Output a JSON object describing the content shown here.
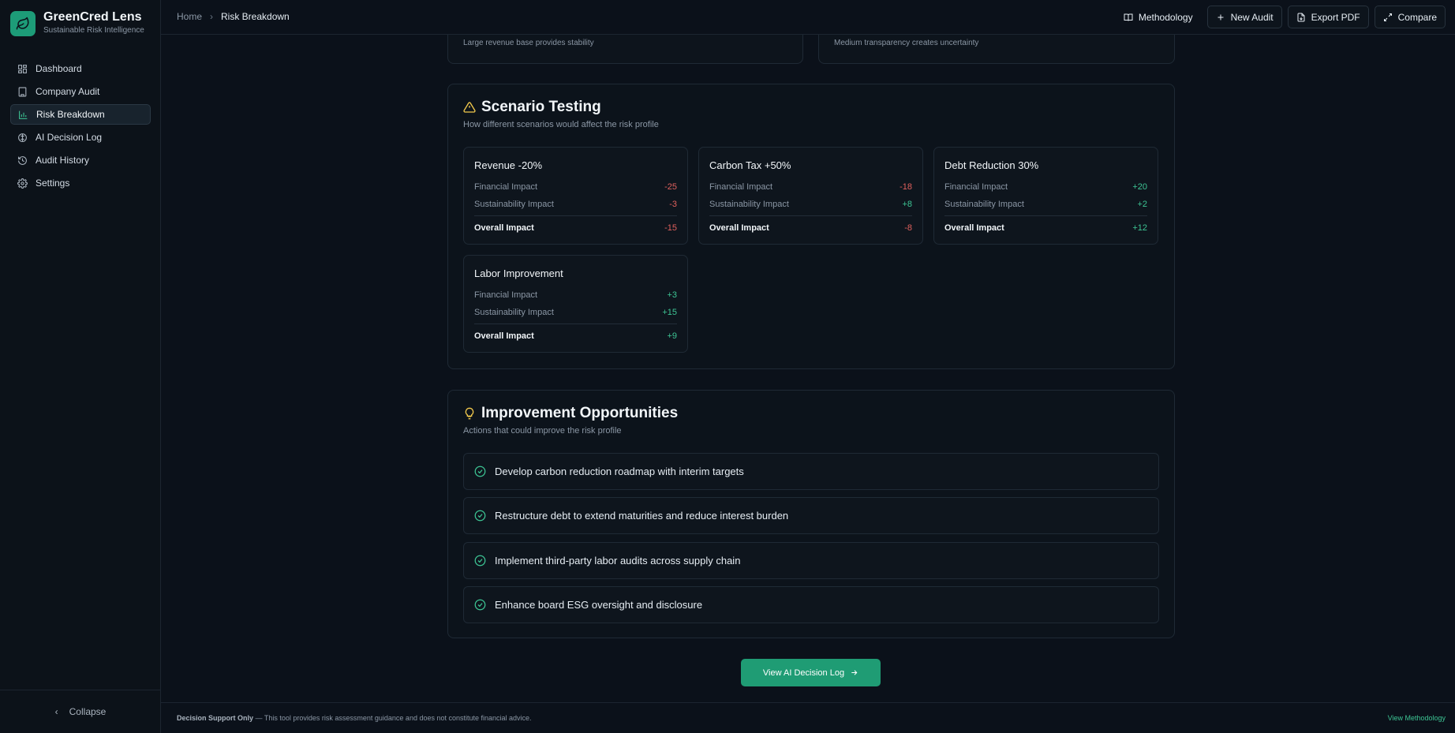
{
  "brand": {
    "name": "GreenCred Lens",
    "subtitle": "Sustainable Risk Intelligence"
  },
  "sidebar": {
    "items": [
      {
        "label": "Dashboard",
        "icon": "dashboard-icon"
      },
      {
        "label": "Company Audit",
        "icon": "building-icon"
      },
      {
        "label": "Risk Breakdown",
        "icon": "bar-chart-icon",
        "active": true
      },
      {
        "label": "AI Decision Log",
        "icon": "brain-icon"
      },
      {
        "label": "Audit History",
        "icon": "history-icon"
      },
      {
        "label": "Settings",
        "icon": "gear-icon"
      }
    ],
    "collapse_label": "Collapse"
  },
  "header": {
    "breadcrumb": {
      "home": "Home",
      "current": "Risk Breakdown"
    },
    "actions": {
      "methodology": "Methodology",
      "new_audit": "New Audit",
      "export_pdf": "Export PDF",
      "compare": "Compare"
    }
  },
  "top_cards": {
    "left_note": "Large revenue base provides stability",
    "right_note": "Medium transparency creates uncertainty"
  },
  "scenario": {
    "title": "Scenario Testing",
    "description": "How different scenarios would affect the risk profile",
    "labels": {
      "financial": "Financial Impact",
      "sustainability": "Sustainability Impact",
      "overall": "Overall Impact"
    },
    "cards": [
      {
        "title": "Revenue -20%",
        "financial": "-25",
        "sustainability": "-3",
        "overall": "-15"
      },
      {
        "title": "Carbon Tax +50%",
        "financial": "-18",
        "sustainability": "+8",
        "overall": "-8"
      },
      {
        "title": "Debt Reduction 30%",
        "financial": "+20",
        "sustainability": "+2",
        "overall": "+12"
      },
      {
        "title": "Labor Improvement",
        "financial": "+3",
        "sustainability": "+15",
        "overall": "+9"
      }
    ]
  },
  "opportunities": {
    "title": "Improvement Opportunities",
    "description": "Actions that could improve the risk profile",
    "items": [
      "Develop carbon reduction roadmap with interim targets",
      "Restructure debt to extend maturities and reduce interest burden",
      "Implement third-party labor audits across supply chain",
      "Enhance board ESG oversight and disclosure"
    ]
  },
  "cta": {
    "label": "View AI Decision Log"
  },
  "footer": {
    "bold": "Decision Support Only",
    "text": " — This tool provides risk assessment guidance and does not constitute financial advice.",
    "link": "View Methodology"
  },
  "colors": {
    "accent": "#1f9c74",
    "positive": "#3dc594",
    "negative": "#e0605d",
    "warning": "#f2c94c"
  }
}
